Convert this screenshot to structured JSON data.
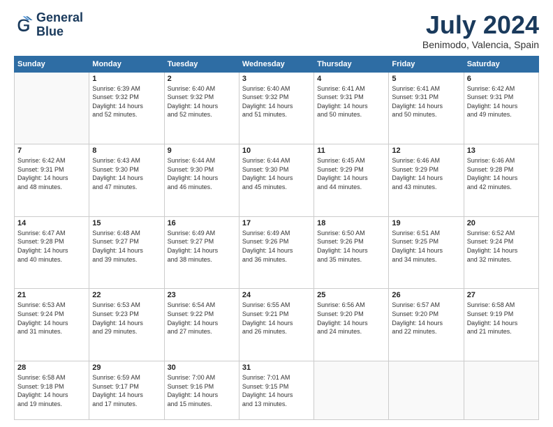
{
  "logo": {
    "line1": "General",
    "line2": "Blue"
  },
  "title": "July 2024",
  "subtitle": "Benimodo, Valencia, Spain",
  "header_days": [
    "Sunday",
    "Monday",
    "Tuesday",
    "Wednesday",
    "Thursday",
    "Friday",
    "Saturday"
  ],
  "weeks": [
    [
      {
        "day": "",
        "info": ""
      },
      {
        "day": "1",
        "info": "Sunrise: 6:39 AM\nSunset: 9:32 PM\nDaylight: 14 hours\nand 52 minutes."
      },
      {
        "day": "2",
        "info": "Sunrise: 6:40 AM\nSunset: 9:32 PM\nDaylight: 14 hours\nand 52 minutes."
      },
      {
        "day": "3",
        "info": "Sunrise: 6:40 AM\nSunset: 9:32 PM\nDaylight: 14 hours\nand 51 minutes."
      },
      {
        "day": "4",
        "info": "Sunrise: 6:41 AM\nSunset: 9:31 PM\nDaylight: 14 hours\nand 50 minutes."
      },
      {
        "day": "5",
        "info": "Sunrise: 6:41 AM\nSunset: 9:31 PM\nDaylight: 14 hours\nand 50 minutes."
      },
      {
        "day": "6",
        "info": "Sunrise: 6:42 AM\nSunset: 9:31 PM\nDaylight: 14 hours\nand 49 minutes."
      }
    ],
    [
      {
        "day": "7",
        "info": "Sunrise: 6:42 AM\nSunset: 9:31 PM\nDaylight: 14 hours\nand 48 minutes."
      },
      {
        "day": "8",
        "info": "Sunrise: 6:43 AM\nSunset: 9:30 PM\nDaylight: 14 hours\nand 47 minutes."
      },
      {
        "day": "9",
        "info": "Sunrise: 6:44 AM\nSunset: 9:30 PM\nDaylight: 14 hours\nand 46 minutes."
      },
      {
        "day": "10",
        "info": "Sunrise: 6:44 AM\nSunset: 9:30 PM\nDaylight: 14 hours\nand 45 minutes."
      },
      {
        "day": "11",
        "info": "Sunrise: 6:45 AM\nSunset: 9:29 PM\nDaylight: 14 hours\nand 44 minutes."
      },
      {
        "day": "12",
        "info": "Sunrise: 6:46 AM\nSunset: 9:29 PM\nDaylight: 14 hours\nand 43 minutes."
      },
      {
        "day": "13",
        "info": "Sunrise: 6:46 AM\nSunset: 9:28 PM\nDaylight: 14 hours\nand 42 minutes."
      }
    ],
    [
      {
        "day": "14",
        "info": "Sunrise: 6:47 AM\nSunset: 9:28 PM\nDaylight: 14 hours\nand 40 minutes."
      },
      {
        "day": "15",
        "info": "Sunrise: 6:48 AM\nSunset: 9:27 PM\nDaylight: 14 hours\nand 39 minutes."
      },
      {
        "day": "16",
        "info": "Sunrise: 6:49 AM\nSunset: 9:27 PM\nDaylight: 14 hours\nand 38 minutes."
      },
      {
        "day": "17",
        "info": "Sunrise: 6:49 AM\nSunset: 9:26 PM\nDaylight: 14 hours\nand 36 minutes."
      },
      {
        "day": "18",
        "info": "Sunrise: 6:50 AM\nSunset: 9:26 PM\nDaylight: 14 hours\nand 35 minutes."
      },
      {
        "day": "19",
        "info": "Sunrise: 6:51 AM\nSunset: 9:25 PM\nDaylight: 14 hours\nand 34 minutes."
      },
      {
        "day": "20",
        "info": "Sunrise: 6:52 AM\nSunset: 9:24 PM\nDaylight: 14 hours\nand 32 minutes."
      }
    ],
    [
      {
        "day": "21",
        "info": "Sunrise: 6:53 AM\nSunset: 9:24 PM\nDaylight: 14 hours\nand 31 minutes."
      },
      {
        "day": "22",
        "info": "Sunrise: 6:53 AM\nSunset: 9:23 PM\nDaylight: 14 hours\nand 29 minutes."
      },
      {
        "day": "23",
        "info": "Sunrise: 6:54 AM\nSunset: 9:22 PM\nDaylight: 14 hours\nand 27 minutes."
      },
      {
        "day": "24",
        "info": "Sunrise: 6:55 AM\nSunset: 9:21 PM\nDaylight: 14 hours\nand 26 minutes."
      },
      {
        "day": "25",
        "info": "Sunrise: 6:56 AM\nSunset: 9:20 PM\nDaylight: 14 hours\nand 24 minutes."
      },
      {
        "day": "26",
        "info": "Sunrise: 6:57 AM\nSunset: 9:20 PM\nDaylight: 14 hours\nand 22 minutes."
      },
      {
        "day": "27",
        "info": "Sunrise: 6:58 AM\nSunset: 9:19 PM\nDaylight: 14 hours\nand 21 minutes."
      }
    ],
    [
      {
        "day": "28",
        "info": "Sunrise: 6:58 AM\nSunset: 9:18 PM\nDaylight: 14 hours\nand 19 minutes."
      },
      {
        "day": "29",
        "info": "Sunrise: 6:59 AM\nSunset: 9:17 PM\nDaylight: 14 hours\nand 17 minutes."
      },
      {
        "day": "30",
        "info": "Sunrise: 7:00 AM\nSunset: 9:16 PM\nDaylight: 14 hours\nand 15 minutes."
      },
      {
        "day": "31",
        "info": "Sunrise: 7:01 AM\nSunset: 9:15 PM\nDaylight: 14 hours\nand 13 minutes."
      },
      {
        "day": "",
        "info": ""
      },
      {
        "day": "",
        "info": ""
      },
      {
        "day": "",
        "info": ""
      }
    ]
  ]
}
